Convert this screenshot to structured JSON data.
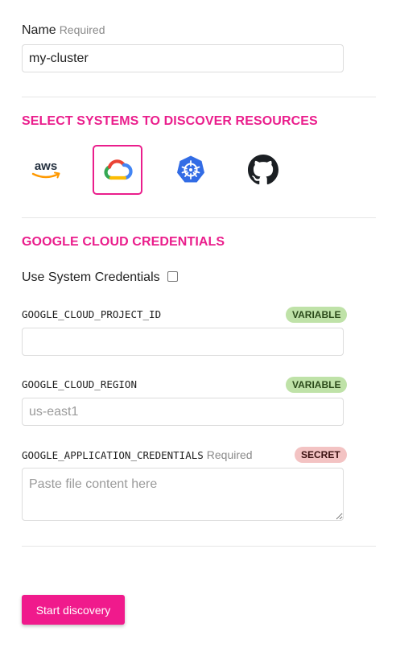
{
  "name_field": {
    "label": "Name",
    "required": "Required",
    "value": "my-cluster"
  },
  "systems": {
    "title": "SELECT SYSTEMS TO DISCOVER RESOURCES",
    "providers": [
      {
        "name": "aws",
        "label": "aws",
        "selected": false,
        "icon": "aws-icon"
      },
      {
        "name": "google-cloud",
        "selected": true,
        "icon": "google-cloud-icon"
      },
      {
        "name": "kubernetes",
        "selected": false,
        "icon": "kubernetes-icon"
      },
      {
        "name": "github",
        "selected": false,
        "icon": "github-icon"
      }
    ],
    "accent_color": "#ea1e8c"
  },
  "credentials": {
    "title": "GOOGLE CLOUD CREDENTIALS",
    "use_system_label": "Use System Credentials",
    "use_system_checked": false,
    "fields": [
      {
        "key": "GOOGLE_CLOUD_PROJECT_ID",
        "badge": "VARIABLE",
        "value": "",
        "placeholder": ""
      },
      {
        "key": "GOOGLE_CLOUD_REGION",
        "badge": "VARIABLE",
        "value": "",
        "placeholder": "us-east1"
      },
      {
        "key": "GOOGLE_APPLICATION_CREDENTIALS",
        "required": "Required",
        "badge": "SECRET",
        "value": "",
        "placeholder": "Paste file content here"
      }
    ]
  },
  "actions": {
    "start_label": "Start discovery",
    "button_color": "#f01a8c"
  }
}
